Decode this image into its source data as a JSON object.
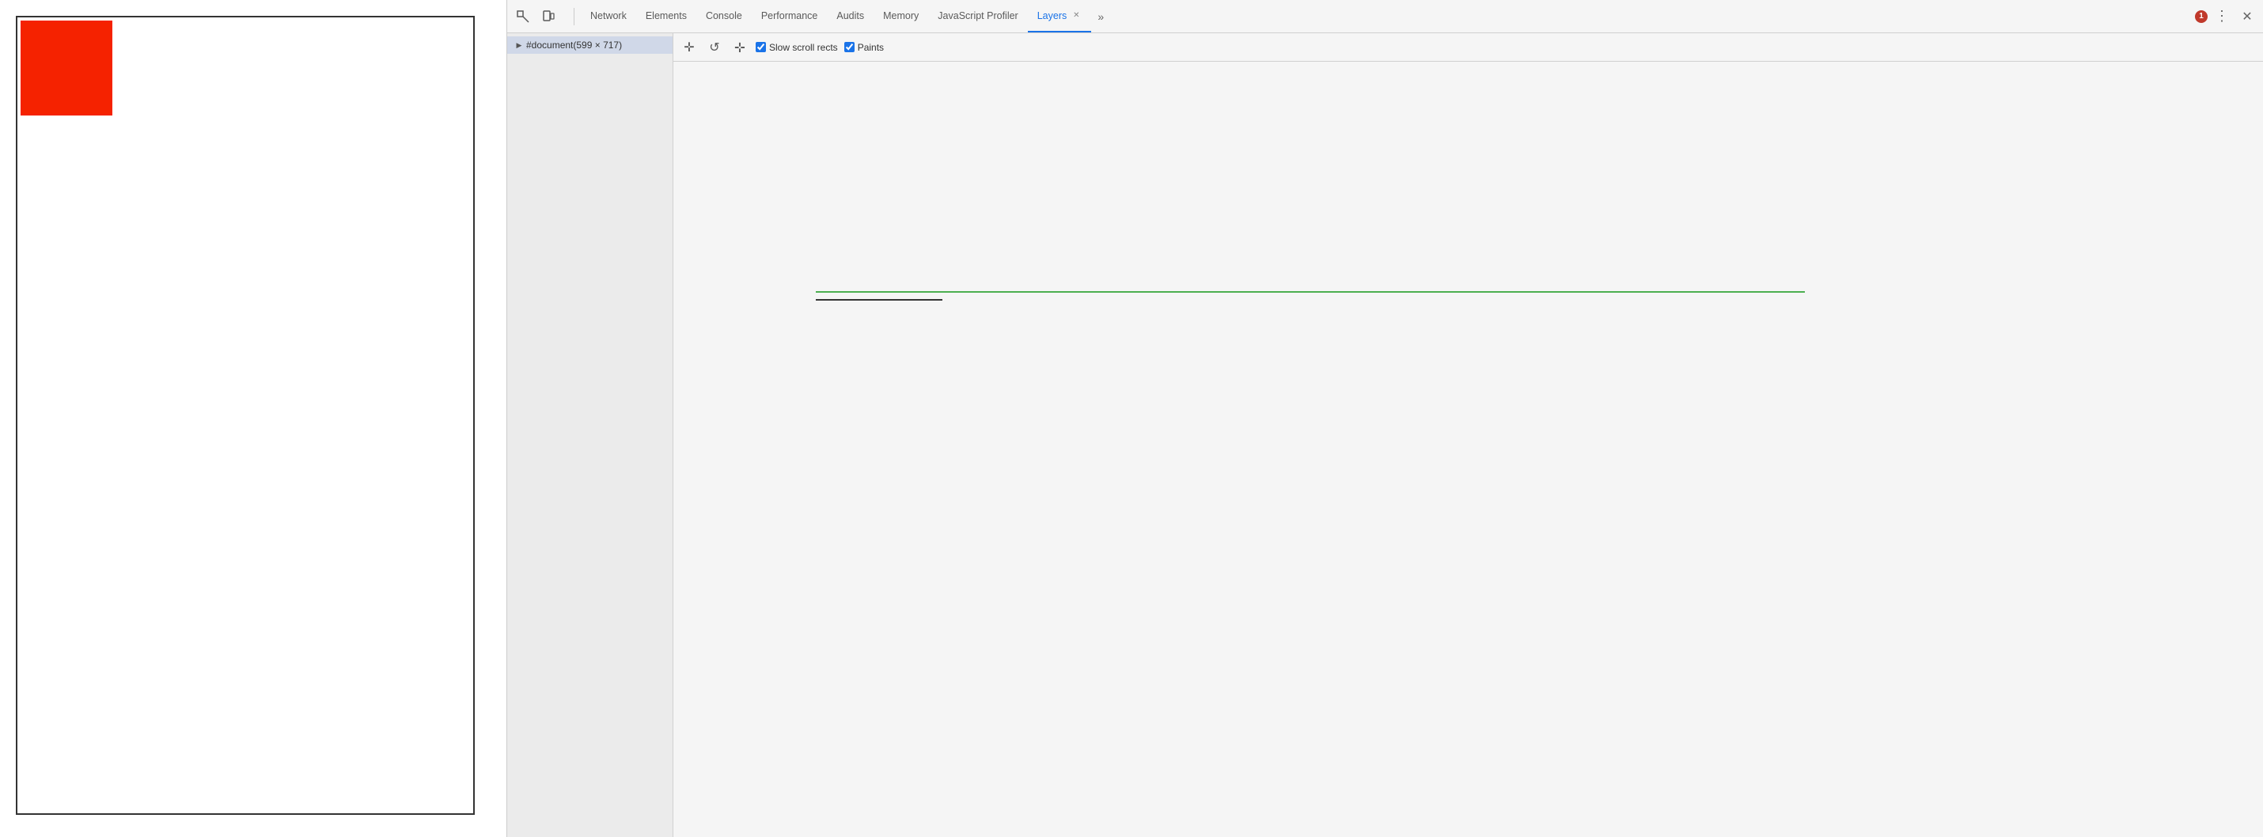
{
  "viewport": {
    "red_box_visible": true
  },
  "devtools": {
    "tabs": [
      {
        "id": "network",
        "label": "Network",
        "active": false,
        "closeable": false
      },
      {
        "id": "elements",
        "label": "Elements",
        "active": false,
        "closeable": false
      },
      {
        "id": "console",
        "label": "Console",
        "active": false,
        "closeable": false
      },
      {
        "id": "performance",
        "label": "Performance",
        "active": false,
        "closeable": false
      },
      {
        "id": "audits",
        "label": "Audits",
        "active": false,
        "closeable": false
      },
      {
        "id": "memory",
        "label": "Memory",
        "active": false,
        "closeable": false
      },
      {
        "id": "javascript-profiler",
        "label": "JavaScript Profiler",
        "active": false,
        "closeable": false
      },
      {
        "id": "layers",
        "label": "Layers",
        "active": true,
        "closeable": true
      }
    ],
    "error_count": "1",
    "layers_panel": {
      "tree_item": "#document(599 × 717)",
      "secondary_toolbar": {
        "pan_icon": "✛",
        "rotate_icon": "↻",
        "move_icon": "⊹",
        "slow_scroll_rects_label": "Slow scroll rects",
        "slow_scroll_rects_checked": true,
        "paints_label": "Paints",
        "paints_checked": true
      }
    }
  }
}
